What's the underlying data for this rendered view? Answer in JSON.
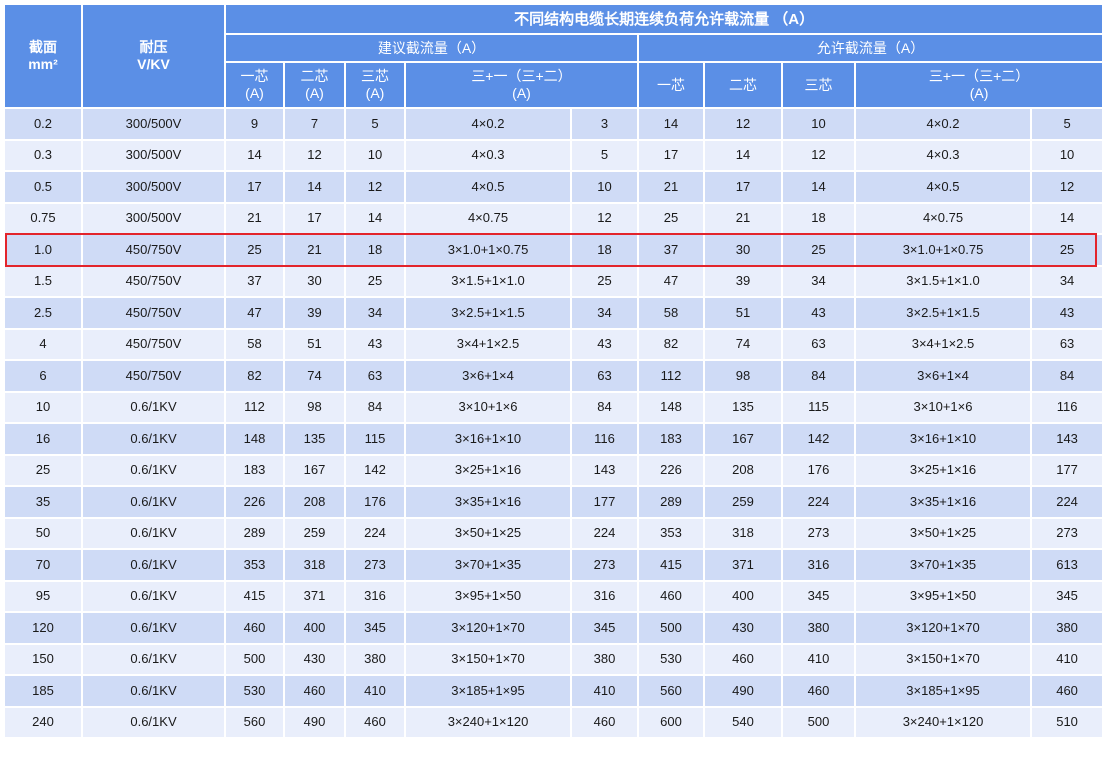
{
  "header": {
    "cross_section_label": "截面",
    "cross_section_unit": "mm²",
    "voltage_label": "耐压",
    "voltage_unit": "V/KV",
    "main_title": "不同结构电缆长期连续负荷允许载流量 （A）",
    "group_recommended": "建议截流量（A）",
    "group_allowed": "允许截流量（A）",
    "rec_one_core": "一芯",
    "rec_one_core_unit": "(A)",
    "rec_two_core": "二芯",
    "rec_two_core_unit": "(A)",
    "rec_three_core": "三芯",
    "rec_three_core_unit": "(A)",
    "rec_combo": "三+一（三+二）",
    "rec_combo_unit": "(A)",
    "allow_one_core": "一芯",
    "allow_two_core": "二芯",
    "allow_three_core": "三芯",
    "allow_combo": "三+一（三+二）",
    "allow_combo_unit": "(A)"
  },
  "highlight_row": "1.0",
  "rows": [
    {
      "size": "0.2",
      "voltage": "300/500V",
      "r1": "9",
      "r2": "7",
      "r3": "5",
      "rspec": "4×0.2",
      "rcombo": "3",
      "a1": "14",
      "a2": "12",
      "a3": "10",
      "aspec": "4×0.2",
      "acombo": "5"
    },
    {
      "size": "0.3",
      "voltage": "300/500V",
      "r1": "14",
      "r2": "12",
      "r3": "10",
      "rspec": "4×0.3",
      "rcombo": "5",
      "a1": "17",
      "a2": "14",
      "a3": "12",
      "aspec": "4×0.3",
      "acombo": "10"
    },
    {
      "size": "0.5",
      "voltage": "300/500V",
      "r1": "17",
      "r2": "14",
      "r3": "12",
      "rspec": "4×0.5",
      "rcombo": "10",
      "a1": "21",
      "a2": "17",
      "a3": "14",
      "aspec": "4×0.5",
      "acombo": "12"
    },
    {
      "size": "0.75",
      "voltage": "300/500V",
      "r1": "21",
      "r2": "17",
      "r3": "14",
      "rspec": "4×0.75",
      "rcombo": "12",
      "a1": "25",
      "a2": "21",
      "a3": "18",
      "aspec": "4×0.75",
      "acombo": "14"
    },
    {
      "size": "1.0",
      "voltage": "450/750V",
      "r1": "25",
      "r2": "21",
      "r3": "18",
      "rspec": "3×1.0+1×0.75",
      "rcombo": "18",
      "a1": "37",
      "a2": "30",
      "a3": "25",
      "aspec": "3×1.0+1×0.75",
      "acombo": "25"
    },
    {
      "size": "1.5",
      "voltage": "450/750V",
      "r1": "37",
      "r2": "30",
      "r3": "25",
      "rspec": "3×1.5+1×1.0",
      "rcombo": "25",
      "a1": "47",
      "a2": "39",
      "a3": "34",
      "aspec": "3×1.5+1×1.0",
      "acombo": "34"
    },
    {
      "size": "2.5",
      "voltage": "450/750V",
      "r1": "47",
      "r2": "39",
      "r3": "34",
      "rspec": "3×2.5+1×1.5",
      "rcombo": "34",
      "a1": "58",
      "a2": "51",
      "a3": "43",
      "aspec": "3×2.5+1×1.5",
      "acombo": "43"
    },
    {
      "size": "4",
      "voltage": "450/750V",
      "r1": "58",
      "r2": "51",
      "r3": "43",
      "rspec": "3×4+1×2.5",
      "rcombo": "43",
      "a1": "82",
      "a2": "74",
      "a3": "63",
      "aspec": "3×4+1×2.5",
      "acombo": "63"
    },
    {
      "size": "6",
      "voltage": "450/750V",
      "r1": "82",
      "r2": "74",
      "r3": "63",
      "rspec": "3×6+1×4",
      "rcombo": "63",
      "a1": "112",
      "a2": "98",
      "a3": "84",
      "aspec": "3×6+1×4",
      "acombo": "84"
    },
    {
      "size": "10",
      "voltage": "0.6/1KV",
      "r1": "112",
      "r2": "98",
      "r3": "84",
      "rspec": "3×10+1×6",
      "rcombo": "84",
      "a1": "148",
      "a2": "135",
      "a3": "115",
      "aspec": "3×10+1×6",
      "acombo": "116"
    },
    {
      "size": "16",
      "voltage": "0.6/1KV",
      "r1": "148",
      "r2": "135",
      "r3": "115",
      "rspec": "3×16+1×10",
      "rcombo": "116",
      "a1": "183",
      "a2": "167",
      "a3": "142",
      "aspec": "3×16+1×10",
      "acombo": "143"
    },
    {
      "size": "25",
      "voltage": "0.6/1KV",
      "r1": "183",
      "r2": "167",
      "r3": "142",
      "rspec": "3×25+1×16",
      "rcombo": "143",
      "a1": "226",
      "a2": "208",
      "a3": "176",
      "aspec": "3×25+1×16",
      "acombo": "177"
    },
    {
      "size": "35",
      "voltage": "0.6/1KV",
      "r1": "226",
      "r2": "208",
      "r3": "176",
      "rspec": "3×35+1×16",
      "rcombo": "177",
      "a1": "289",
      "a2": "259",
      "a3": "224",
      "aspec": "3×35+1×16",
      "acombo": "224"
    },
    {
      "size": "50",
      "voltage": "0.6/1KV",
      "r1": "289",
      "r2": "259",
      "r3": "224",
      "rspec": "3×50+1×25",
      "rcombo": "224",
      "a1": "353",
      "a2": "318",
      "a3": "273",
      "aspec": "3×50+1×25",
      "acombo": "273"
    },
    {
      "size": "70",
      "voltage": "0.6/1KV",
      "r1": "353",
      "r2": "318",
      "r3": "273",
      "rspec": "3×70+1×35",
      "rcombo": "273",
      "a1": "415",
      "a2": "371",
      "a3": "316",
      "aspec": "3×70+1×35",
      "acombo": "613"
    },
    {
      "size": "95",
      "voltage": "0.6/1KV",
      "r1": "415",
      "r2": "371",
      "r3": "316",
      "rspec": "3×95+1×50",
      "rcombo": "316",
      "a1": "460",
      "a2": "400",
      "a3": "345",
      "aspec": "3×95+1×50",
      "acombo": "345"
    },
    {
      "size": "120",
      "voltage": "0.6/1KV",
      "r1": "460",
      "r2": "400",
      "r3": "345",
      "rspec": "3×120+1×70",
      "rcombo": "345",
      "a1": "500",
      "a2": "430",
      "a3": "380",
      "aspec": "3×120+1×70",
      "acombo": "380"
    },
    {
      "size": "150",
      "voltage": "0.6/1KV",
      "r1": "500",
      "r2": "430",
      "r3": "380",
      "rspec": "3×150+1×70",
      "rcombo": "380",
      "a1": "530",
      "a2": "460",
      "a3": "410",
      "aspec": "3×150+1×70",
      "acombo": "410"
    },
    {
      "size": "185",
      "voltage": "0.6/1KV",
      "r1": "530",
      "r2": "460",
      "r3": "410",
      "rspec": "3×185+1×95",
      "rcombo": "410",
      "a1": "560",
      "a2": "490",
      "a3": "460",
      "aspec": "3×185+1×95",
      "acombo": "460"
    },
    {
      "size": "240",
      "voltage": "0.6/1KV",
      "r1": "560",
      "r2": "490",
      "r3": "460",
      "rspec": "3×240+1×120",
      "rcombo": "460",
      "a1": "600",
      "a2": "540",
      "a3": "500",
      "aspec": "3×240+1×120",
      "acombo": "510"
    }
  ]
}
